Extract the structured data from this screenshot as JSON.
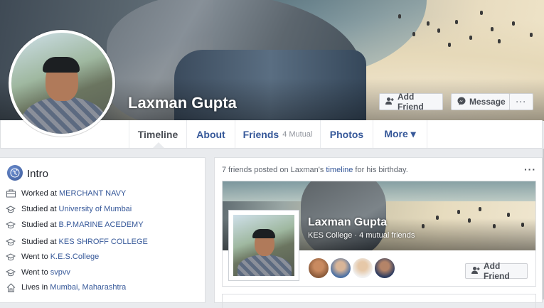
{
  "profile": {
    "name": "Laxman Gupta",
    "actions": {
      "add_friend": "Add Friend",
      "message": "Message",
      "more": "···"
    }
  },
  "nav": {
    "tabs": [
      {
        "label": "Timeline"
      },
      {
        "label": "About"
      },
      {
        "label": "Friends",
        "meta": "4 Mutual"
      },
      {
        "label": "Photos"
      },
      {
        "label": "More ▾"
      }
    ]
  },
  "intro": {
    "title": "Intro",
    "items": [
      {
        "prefix": "Worked at",
        "link": "MERCHANT NAVY",
        "icon": "briefcase-icon"
      },
      {
        "prefix": "Studied at",
        "link": "University of Mumbai",
        "icon": "graduation-cap-icon"
      },
      {
        "prefix": "Studied at",
        "link": "B.P.MARINE ACEDEMY",
        "icon": "graduation-cap-icon"
      },
      {
        "prefix": "Studied at",
        "link": "KES SHROFF COLLEGE",
        "icon": "graduation-cap-icon"
      },
      {
        "prefix": "Went to",
        "link": "K.E.S.College",
        "icon": "graduation-cap-icon"
      },
      {
        "prefix": "Went to",
        "link": "svpvv",
        "icon": "graduation-cap-icon"
      },
      {
        "prefix": "Lives in",
        "link": "Mumbai, Maharashtra",
        "icon": "home-icon"
      }
    ]
  },
  "feed": {
    "header_prefix": "7 friends posted on Laxman's",
    "header_link": "timeline",
    "header_suffix": "for his birthday.",
    "menu": "···",
    "card": {
      "name": "Laxman Gupta",
      "subtitle": "KES College · 4 mutual friends",
      "add_friend": "Add Friend"
    }
  },
  "colors": {
    "link": "#365899",
    "background": "#e9ebee",
    "border": "#dddfe2"
  }
}
